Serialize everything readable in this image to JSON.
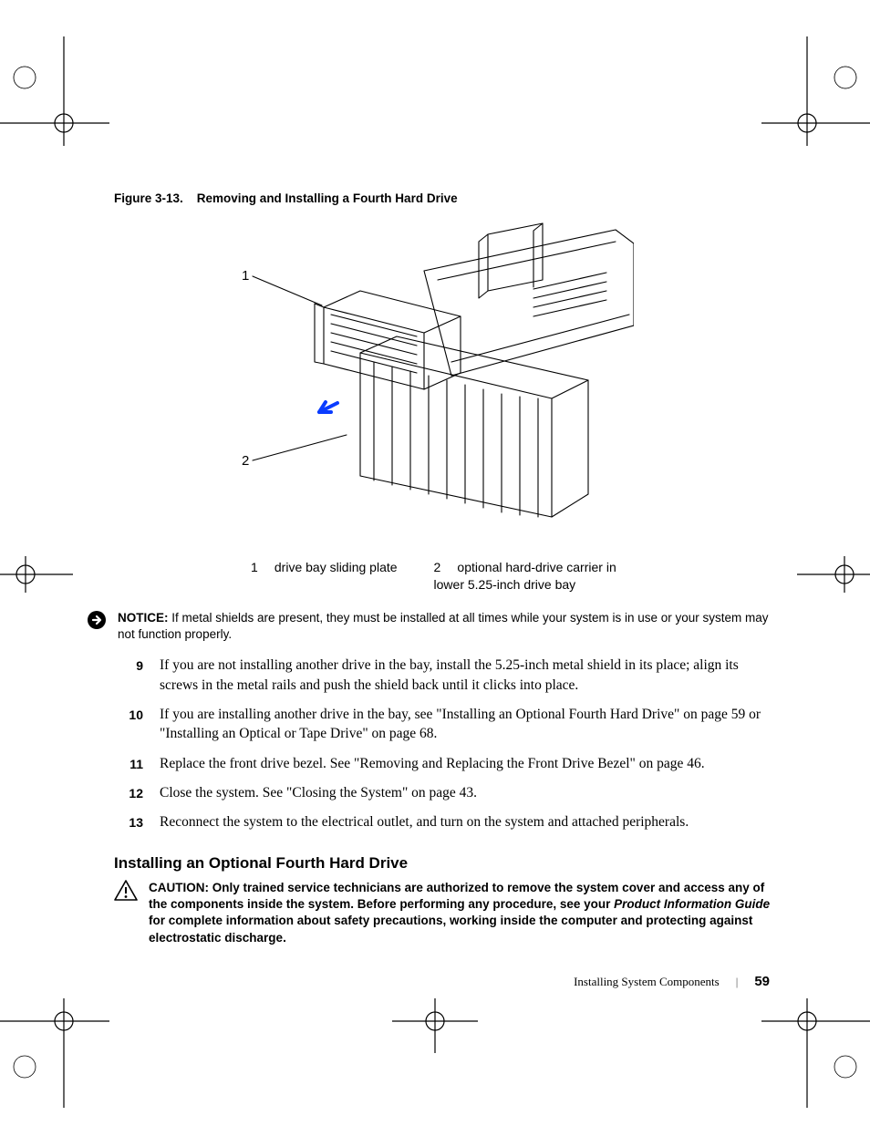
{
  "figure": {
    "caption_prefix": "Figure 3-13.",
    "caption_title": "Removing and Installing a Fourth Hard Drive",
    "callouts": {
      "one": "1",
      "two": "2"
    },
    "legend": [
      {
        "n": "1",
        "text": "drive bay sliding plate"
      },
      {
        "n": "2",
        "text": "optional hard-drive carrier in lower 5.25-inch drive bay"
      }
    ]
  },
  "notice": {
    "label": "NOTICE:",
    "text": "If metal shields are present, they must be installed at all times while your system is in use or your system may not function properly."
  },
  "steps": [
    {
      "n": "9",
      "text": "If you are not installing another drive in the bay, install the 5.25-inch metal shield in its place; align its screws in the metal rails and push the shield back until it clicks into place."
    },
    {
      "n": "10",
      "text": "If you are installing another drive in the bay, see \"Installing an Optional Fourth Hard Drive\" on page 59 or \"Installing an Optical or Tape Drive\" on page 68."
    },
    {
      "n": "11",
      "text": "Replace the front drive bezel. See \"Removing and Replacing the Front Drive Bezel\" on page 46."
    },
    {
      "n": "12",
      "text": "Close the system. See \"Closing the System\" on page 43."
    },
    {
      "n": "13",
      "text": "Reconnect the system to the electrical outlet, and turn on the system and attached peripherals."
    }
  ],
  "section_heading": "Installing an Optional Fourth Hard Drive",
  "caution": {
    "label": "CAUTION:",
    "before": "Only trained service technicians are authorized to remove the system cover and access any of the components inside the system. Before performing any procedure, see your ",
    "pig": "Product Information Guide",
    "after": " for complete information about safety precautions, working inside the computer and protecting against electrostatic discharge."
  },
  "footer": {
    "section": "Installing System Components",
    "page": "59"
  }
}
